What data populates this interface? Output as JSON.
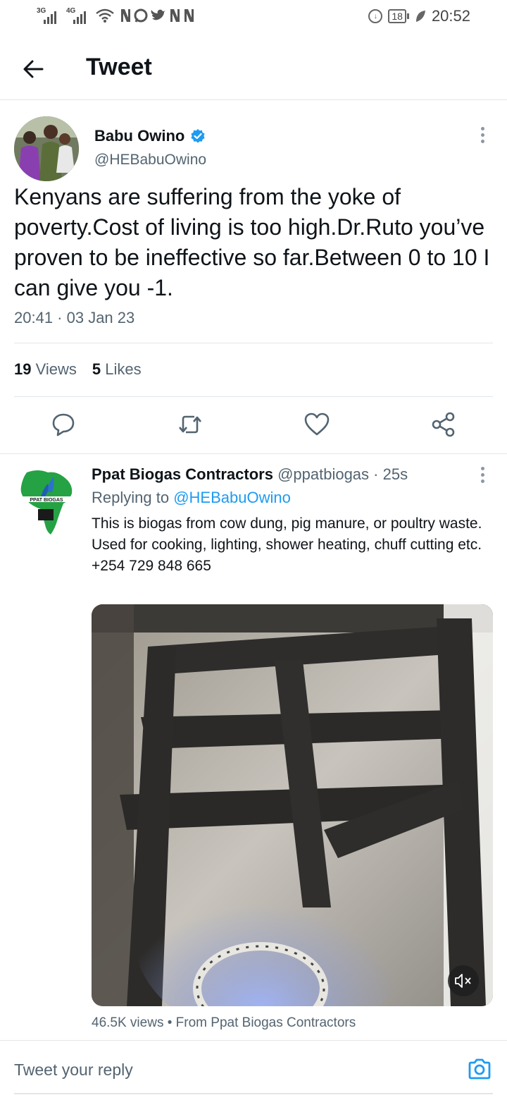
{
  "status_bar": {
    "network_1": "3G",
    "network_2": "4G",
    "app_letters": "N N",
    "battery": "18",
    "time": "20:52"
  },
  "header": {
    "title": "Tweet"
  },
  "main_tweet": {
    "author_name": "Babu Owino",
    "author_handle": "@HEBabuOwino",
    "text": "Kenyans are suffering from the yoke of poverty.Cost of living is too high.Dr.Ruto you’ve proven to be ineffective so far.Between 0 to 10 I can give you -1.",
    "timestamp": "20:41 · 03 Jan 23",
    "views_count": "19",
    "views_label": "Views",
    "likes_count": "5",
    "likes_label": "Likes"
  },
  "reply_tweet": {
    "author_name": "Ppat Biogas Contractors",
    "author_handle": "@ppatbiogas",
    "time_ago": "· 25s",
    "replying_prefix": "Replying to",
    "replying_to": "@HEBabuOwino",
    "text_line1": "This is biogas from cow dung, pig manure, or poultry waste. Used for cooking, lighting, shower heating, chuff cutting etc.",
    "text_line2": "+254 729 848 665",
    "media_views": "46.5K views",
    "media_source": "From Ppat Biogas Contractors",
    "logo_text": "PPAT BIOGAS"
  },
  "composer": {
    "placeholder": "Tweet your reply"
  },
  "colors": {
    "accent": "#1d9bf0",
    "secondary_text": "#536471"
  }
}
